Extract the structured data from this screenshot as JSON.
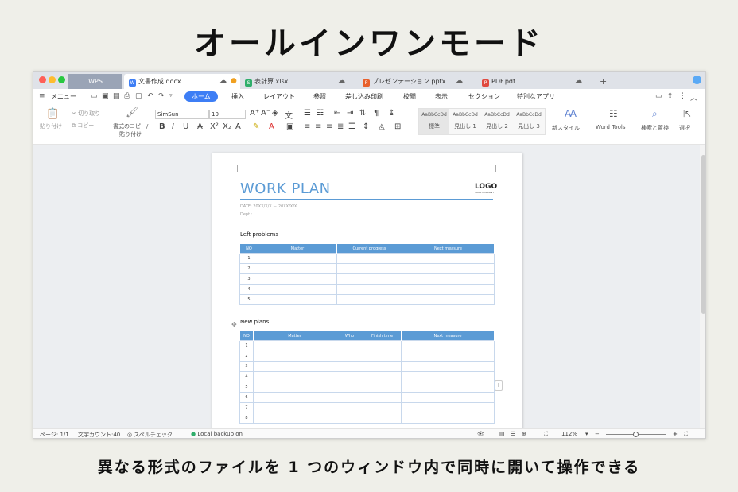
{
  "headline": "オールインワンモード",
  "caption": "異なる形式のファイルを 1 つのウィンドウ内で同時に開いて操作できる",
  "tabs": {
    "wps": "WPS",
    "doc": "文書作成.docx",
    "xlsx": "表計算.xlsx",
    "pptx": "プレゼンテーション.pptx",
    "pdf": "PDF.pdf",
    "add": "+"
  },
  "menu": {
    "hamburger": "≡",
    "menu_label": "メニュー",
    "items": [
      "ホーム",
      "挿入",
      "レイアウト",
      "参照",
      "差し込み印刷",
      "校閲",
      "表示",
      "セクション",
      "特別なアプリ"
    ]
  },
  "ribbon": {
    "paste": "貼り付け",
    "cut": "切り取り",
    "copy": "コピー",
    "format_copy_1": "書式のコピー/",
    "format_copy_2": "貼り付け",
    "font_name": "SimSun",
    "font_size": "10",
    "styles": [
      {
        "preview": "AaBbCcDd",
        "label": "標準"
      },
      {
        "preview": "AaBbCcDd",
        "label": "見出し 1"
      },
      {
        "preview": "AaBbCcDd",
        "label": "見出し 2"
      },
      {
        "preview": "AaBbCcDd",
        "label": "見出し 3"
      }
    ],
    "new_style": "新スタイル",
    "word_tools": "Word Tools",
    "find_replace": "検索と置換",
    "select": "選択"
  },
  "document": {
    "title": "WORK PLAN",
    "logo": "LOGO",
    "logo_sub": "YOUR COMPANY",
    "date": "DATE: 20XX/X/X － 20XX/X/X",
    "dept": "Dept.:",
    "section1": "Left problems",
    "table1": {
      "headers": [
        "NO",
        "Matter",
        "Current progress",
        "Next measure"
      ],
      "rows": [
        "1",
        "2",
        "3",
        "4",
        "5"
      ]
    },
    "section2": "New plans",
    "table2": {
      "headers": [
        "NO",
        "Matter",
        "Who",
        "Finish time",
        "Next measure"
      ],
      "rows": [
        "1",
        "2",
        "3",
        "4",
        "5",
        "6",
        "7",
        "8"
      ]
    }
  },
  "status": {
    "page": "ページ: 1/1",
    "word_count": "文字カウント:40",
    "spell_check": "スペルチェック",
    "backup": "Local backup on",
    "zoom": "112%"
  },
  "colors": {
    "accent": "#3d7ef5",
    "table_header": "#5b9bd5",
    "wps_tab": "#9aa4b6"
  }
}
